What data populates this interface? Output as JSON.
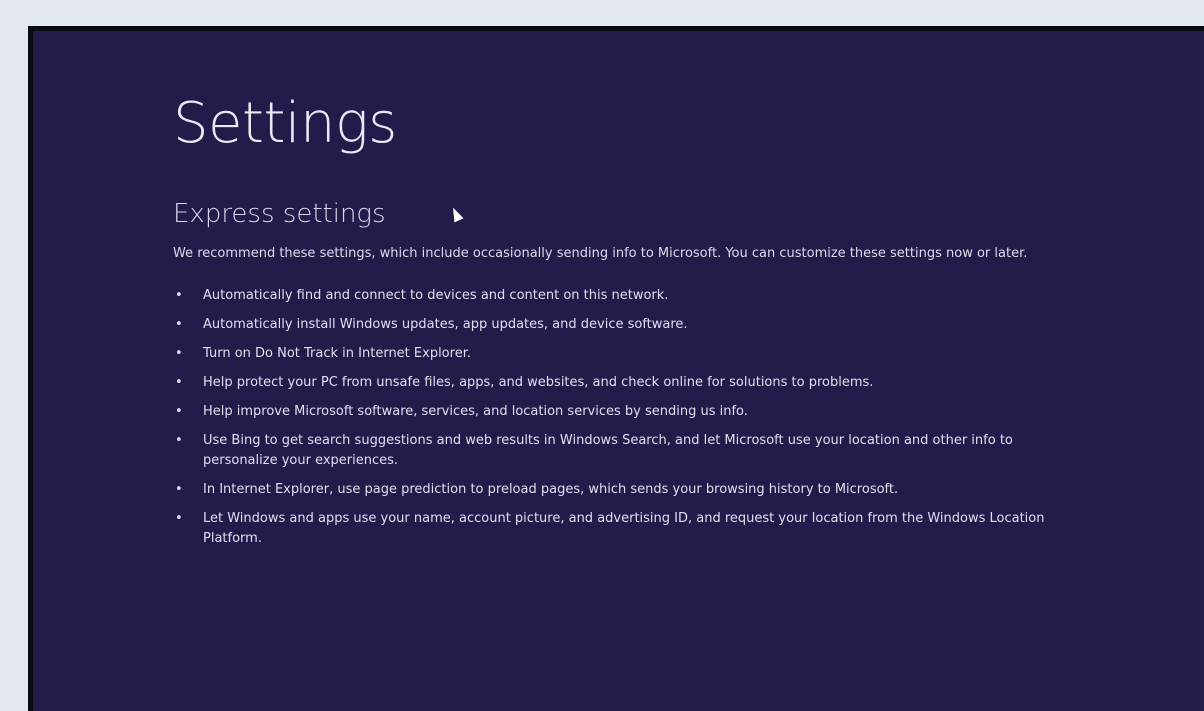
{
  "window": {
    "title": "Settings"
  },
  "express": {
    "heading": "Express settings",
    "intro": "We recommend these settings, which include occasionally sending info to Microsoft. You can customize these settings now or later.",
    "items": [
      "Automatically find and connect to devices and content on this network.",
      "Automatically install Windows updates, app updates, and device software.",
      "Turn on Do Not Track in Internet Explorer.",
      "Help protect your PC from unsafe files, apps, and websites, and check online for solutions to problems.",
      "Help improve Microsoft software, services, and location services by sending us info.",
      "Use Bing to get search suggestions and web results in Windows Search, and let Microsoft use your location and other info to personalize your experiences.",
      "In Internet Explorer, use page prediction to preload pages, which sends your browsing history to Microsoft.",
      "Let Windows and apps use your name, account picture, and advertising ID, and request your location from the Windows Location Platform."
    ]
  },
  "bullet_glyph": "•",
  "icons": {
    "pointer": "mouse-pointer-icon"
  },
  "colors": {
    "screen_background": "#211d4a",
    "page_background": "#e4e8ef",
    "text": "#ece9f6"
  }
}
